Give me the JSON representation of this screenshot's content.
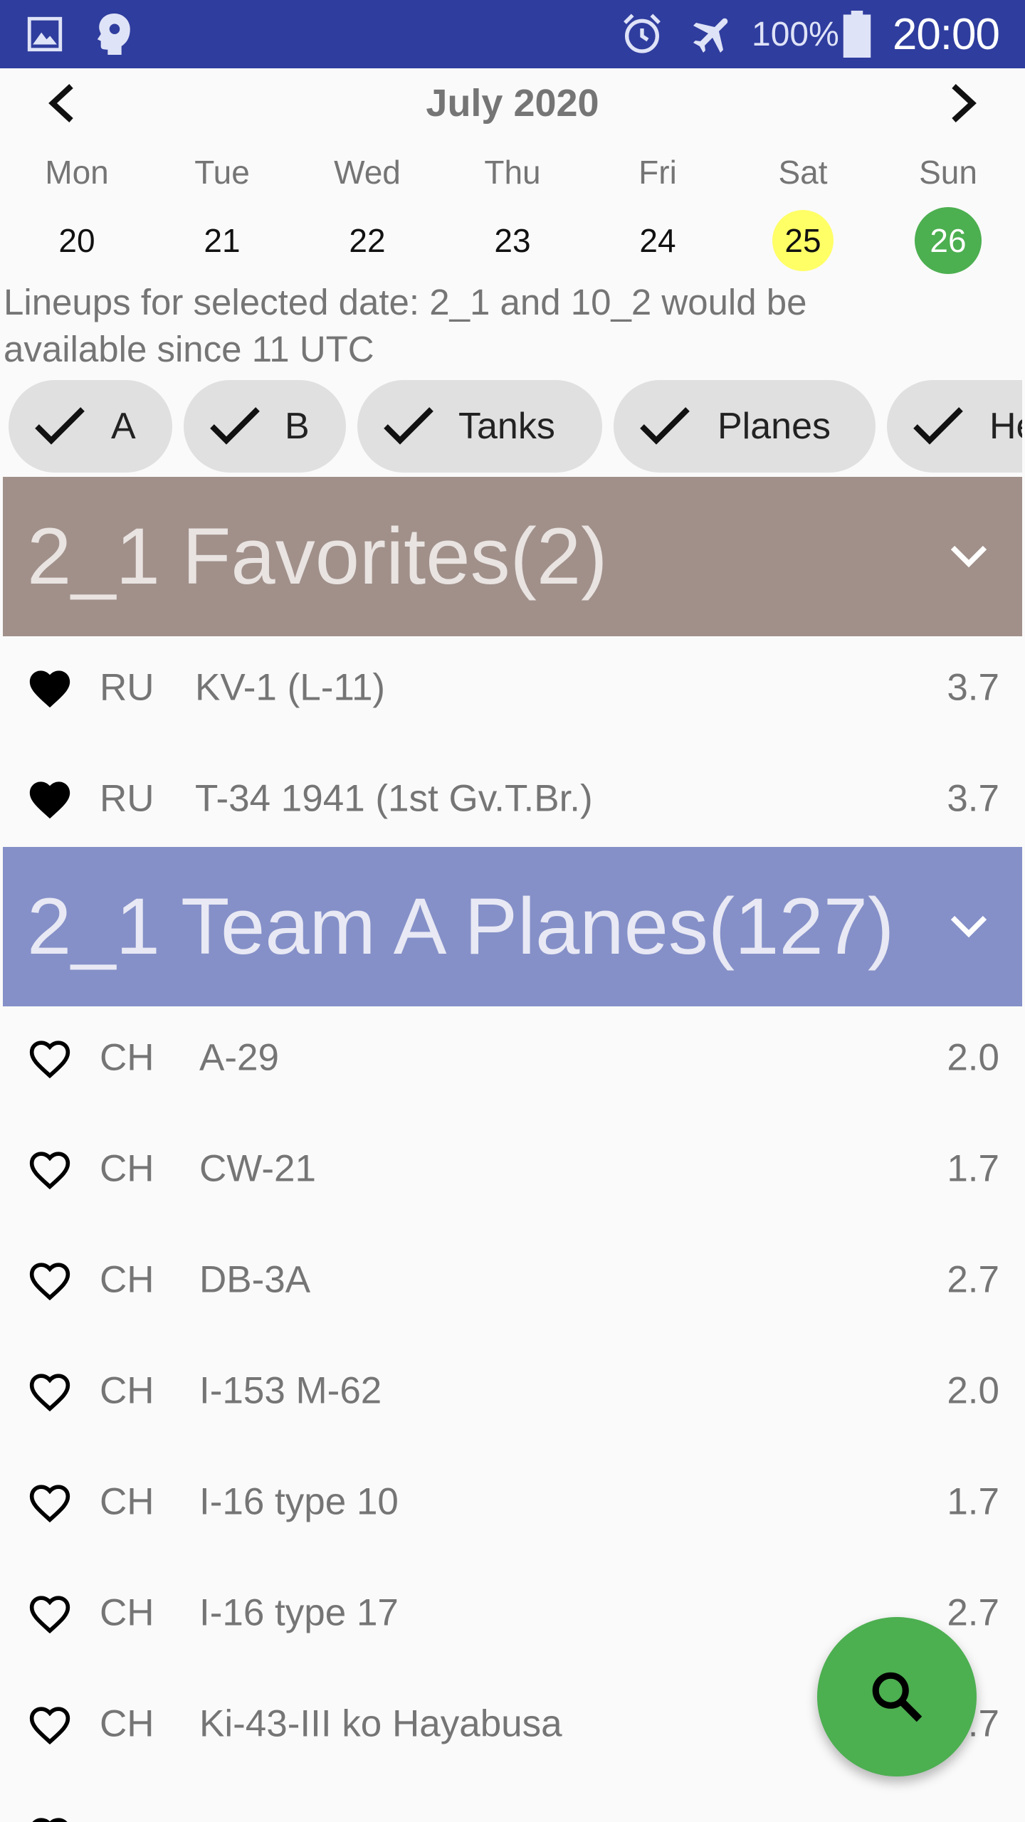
{
  "status_bar": {
    "battery_text": "100%",
    "time": "20:00",
    "icons": [
      "gallery-icon",
      "brain-icon",
      "alarm-icon",
      "airplane-mode-icon",
      "battery-icon"
    ]
  },
  "calendar": {
    "month_title": "July 2020",
    "days": [
      {
        "name": "Mon",
        "num": "20"
      },
      {
        "name": "Tue",
        "num": "21"
      },
      {
        "name": "Wed",
        "num": "22"
      },
      {
        "name": "Thu",
        "num": "23"
      },
      {
        "name": "Fri",
        "num": "24"
      },
      {
        "name": "Sat",
        "num": "25",
        "highlight": "#ffff66"
      },
      {
        "name": "Sun",
        "num": "26",
        "highlight": "#4caf50",
        "selected": true
      }
    ]
  },
  "lineup_text": "Lineups for selected date: 2_1 and 10_2 would be available since 11 UTC",
  "chips": [
    {
      "label": "A",
      "checked": true
    },
    {
      "label": "B",
      "checked": true
    },
    {
      "label": "Tanks",
      "checked": true
    },
    {
      "label": "Planes",
      "checked": true
    },
    {
      "label": "He",
      "checked": true
    }
  ],
  "sections": {
    "favorites": {
      "title": "2_1 Favorites(2)",
      "color": "#a1908a",
      "rows": [
        {
          "country": "RU",
          "name": "KV-1 (L-11)",
          "br": "3.7",
          "favorite": true
        },
        {
          "country": "RU",
          "name": "T-34 1941 (1st Gv.T.Br.)",
          "br": "3.7",
          "favorite": true
        }
      ]
    },
    "planes": {
      "title": "2_1 Team A Planes(127)",
      "color": "#8590c8",
      "rows": [
        {
          "country": "CH",
          "name": "A-29",
          "br": "2.0",
          "favorite": false
        },
        {
          "country": "CH",
          "name": "CW-21",
          "br": "1.7",
          "favorite": false
        },
        {
          "country": "CH",
          "name": "DB-3A",
          "br": "2.7",
          "favorite": false
        },
        {
          "country": "CH",
          "name": "I-153 M-62",
          "br": "2.0",
          "favorite": false
        },
        {
          "country": "CH",
          "name": "I-16 type 10",
          "br": "1.7",
          "favorite": false
        },
        {
          "country": "CH",
          "name": "I-16 type 17",
          "br": "2.7",
          "favorite": false
        },
        {
          "country": "CH",
          "name": "Ki-43-III ko Hayabusa",
          "br": "2.7",
          "favorite": false
        }
      ]
    }
  },
  "fab": {
    "icon": "search-icon",
    "color": "#4caf50"
  }
}
